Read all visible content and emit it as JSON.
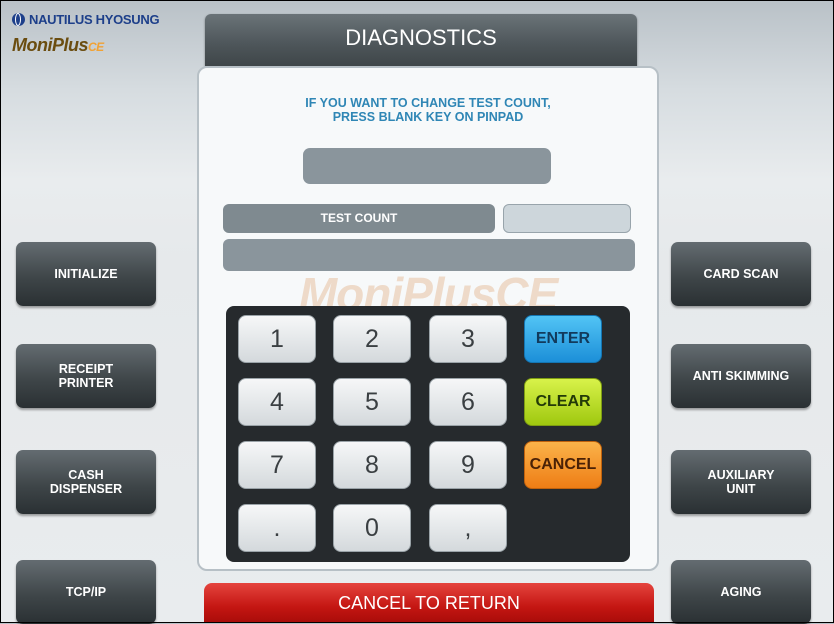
{
  "brand": {
    "company": "NAUTILUS HYOSUNG",
    "product": "MoniPlus",
    "product_suffix": "CE"
  },
  "screen": {
    "title": "DIAGNOSTICS",
    "instruction_line1": "IF YOU WANT TO CHANGE TEST COUNT,",
    "instruction_line2": "PRESS BLANK KEY ON PINPAD",
    "test_count_label": "TEST COUNT",
    "test_count_value": "",
    "watermark": "MoniPlusCE"
  },
  "keypad": {
    "digits": [
      "1",
      "2",
      "3",
      "4",
      "5",
      "6",
      "7",
      "8",
      "9",
      ".",
      "0",
      ","
    ],
    "enter": "ENTER",
    "clear": "CLEAR",
    "cancel": "CANCEL"
  },
  "left_buttons": {
    "initialize": "INITIALIZE",
    "receipt_printer_1": "RECEIPT",
    "receipt_printer_2": "PRINTER",
    "cash_dispenser_1": "CASH",
    "cash_dispenser_2": "DISPENSER",
    "tcpip": "TCP/IP"
  },
  "right_buttons": {
    "card_scan": "CARD SCAN",
    "anti_skimming": "ANTI SKIMMING",
    "auxiliary_unit_1": "AUXILIARY",
    "auxiliary_unit_2": "UNIT",
    "aging": "AGING"
  },
  "bottom": {
    "cancel_to_return": "CANCEL TO RETURN"
  },
  "colors": {
    "title_bar": "#4d5559",
    "instruction_text": "#2f86b5",
    "enter_key": "#1c8fd8",
    "clear_key": "#9fc80f",
    "cancel_key": "#ee7d15",
    "cancel_return_bar": "#c41612"
  }
}
